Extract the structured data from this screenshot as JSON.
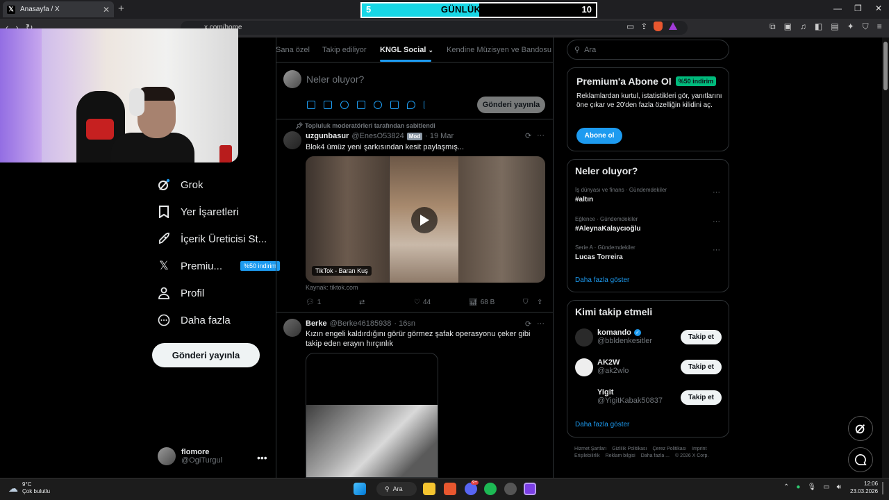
{
  "browser": {
    "tab_title": "Anasayfa / X",
    "new_tab": "+",
    "url": "x.com/home"
  },
  "subscriber_goal": {
    "label": "GÜNLÜK ABONE",
    "current": "5",
    "goal": "10",
    "progress_fraction": 0.5,
    "fill_color": "#17d7e6"
  },
  "sidebar": {
    "items": [
      {
        "label": "Grok",
        "icon": "grok-icon"
      },
      {
        "label": "Yer İşaretleri",
        "icon": "bookmark-icon"
      },
      {
        "label": "İçerik Üreticisi St...",
        "icon": "rocket-icon"
      },
      {
        "label": "Premiu...",
        "icon": "x-logo-icon",
        "badge": "%50 indirim"
      },
      {
        "label": "Profil",
        "icon": "person-icon"
      },
      {
        "label": "Daha fazla",
        "icon": "more-circle-icon"
      }
    ],
    "post_button": "Gönderi yayınla",
    "account": {
      "name": "flomore",
      "handle": "@OgiTurgul"
    }
  },
  "center": {
    "tabs": [
      "Sana özel",
      "Takip ediliyor",
      "KNGL Social",
      "Kendine Müzisyen ve Bandosu"
    ],
    "active_tab": "KNGL Social",
    "composer_placeholder": "Neler oluyor?",
    "composer_post_button": "Gönderi yayınla",
    "tweets": [
      {
        "pinned_note": "Topluluk moderatörleri tarafından sabitlendi",
        "name": "uzgunbasur",
        "handle": "@EnesO53824",
        "badge": "Mod",
        "time": "· 19 Mar",
        "text": "Blok4 ümüz yeni şarkısından kesit paylaşmış...",
        "media_label": "TikTok - Baran Kuş",
        "source": "Kaynak: tiktok.com",
        "replies": "1",
        "retweets": "",
        "likes": "44",
        "views": "68 B"
      },
      {
        "name": "Berke",
        "handle": "@Berke46185938",
        "time": "· 16sn",
        "text": "Kızın engeli kaldırdığını görür görmez şafak operasyonu çeker gibi takip eden erayın hırçınlık"
      }
    ]
  },
  "right": {
    "search_placeholder": "Ara",
    "premium": {
      "title": "Premium'a Abone Ol",
      "badge": "%50 indirim",
      "text": "Reklamlardan kurtul, istatistikleri gör, yanıtlarını öne çıkar ve 20'den fazla özelliğin kilidini aç.",
      "button": "Abone ol"
    },
    "trends": {
      "title": "Neler oluyor?",
      "items": [
        {
          "category": "İş dünyası ve finans · Gündemdekiler",
          "title": "#altın"
        },
        {
          "category": "Eğlence · Gündemdekiler",
          "title": "#AleynaKalaycıoğlu"
        },
        {
          "category": "Serie A · Gündemdekiler",
          "title": "Lucas Torreira"
        }
      ],
      "show_more": "Daha fazla göster"
    },
    "who_to_follow": {
      "title": "Kimi takip etmeli",
      "items": [
        {
          "name": "komando",
          "handle": "@bbldenkesitler",
          "verified": true,
          "button": "Takip et"
        },
        {
          "name": "AK2W",
          "handle": "@ak2wlo",
          "verified": false,
          "button": "Takip et"
        },
        {
          "name": "Yigit",
          "handle": "@YigitKabak50837",
          "verified": false,
          "button": "Takip et"
        }
      ],
      "show_more": "Daha fazla göster"
    },
    "footer": {
      "links": [
        "Hizmet Şartları",
        "Gizlilik Politikası",
        "Çerez Politikası",
        "Imprint",
        "Erişilebilirlik",
        "Reklam bilgisi",
        "Daha fazla ..."
      ],
      "copyright": "© 2026 X Corp."
    }
  },
  "taskbar": {
    "weather_temp": "9°C",
    "weather_desc": "Çok bulutlu",
    "search_label": "Ara",
    "discord_badge": "9+",
    "time": "12:06",
    "date": "23.03.2026"
  },
  "colors": {
    "accent": "#1d9bf0",
    "green_badge": "#00ba7c",
    "background": "#000000"
  }
}
